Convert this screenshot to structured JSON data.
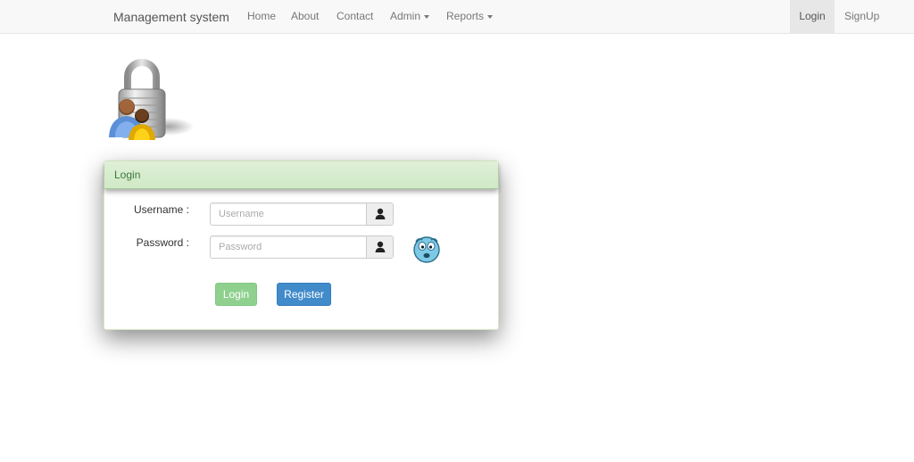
{
  "navbar": {
    "brand": "Management system",
    "left_items": [
      {
        "label": "Home"
      },
      {
        "label": "About"
      },
      {
        "label": "Contact"
      },
      {
        "label": "Admin",
        "dropdown": true
      },
      {
        "label": "Reports",
        "dropdown": true
      }
    ],
    "right_items": [
      {
        "label": "Login",
        "active": true
      },
      {
        "label": "SignUp"
      }
    ]
  },
  "header_icon": "lock-users-icon",
  "panel": {
    "title": "Login",
    "username": {
      "label": "Username :",
      "placeholder": "Username",
      "value": "",
      "icon": "user-icon"
    },
    "password": {
      "label": "Password :",
      "placeholder": "Password",
      "value": "",
      "icon": "user-icon"
    },
    "status_icon": "worried-face-icon",
    "login_button": "Login",
    "register_button": "Register"
  },
  "colors": {
    "panel_heading_bg": "#dff0d8",
    "panel_heading_text": "#3c763d",
    "login_button": "#8fd08f",
    "register_button": "#428bca"
  }
}
